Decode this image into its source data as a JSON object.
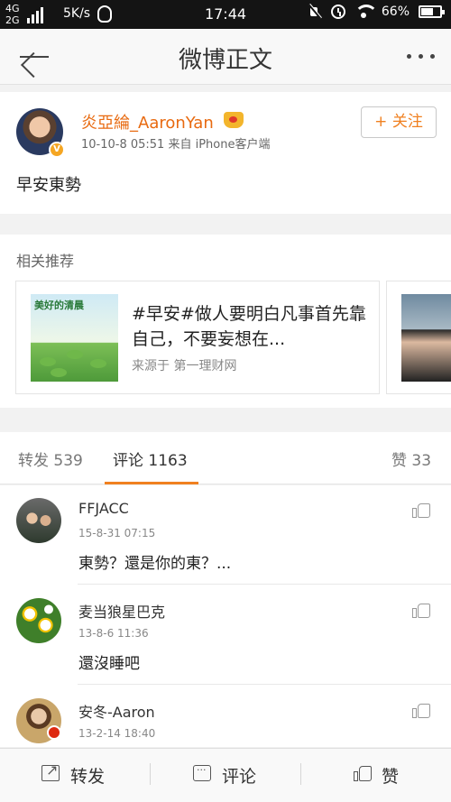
{
  "status_bar": {
    "network_top": "4G",
    "network_bottom": "2G",
    "speed": "5K/s",
    "time": "17:44",
    "battery": "66%"
  },
  "nav": {
    "title": "微博正文"
  },
  "post": {
    "author": "炎亞綸_AaronYan",
    "meta": "10-10-8 05:51  来自 iPhone客户端",
    "follow_label": "+ 关注",
    "text": "早安東勢"
  },
  "related": {
    "title": "相关推荐",
    "card": {
      "thumb_label": "美好的清晨",
      "title": "#早安#做人要明白凡事首先靠自己，不要妄想在...",
      "source": "来源于 第一理财网"
    }
  },
  "tabs": {
    "repost": "转发 539",
    "comment": "评论 1163",
    "like": "赞 33"
  },
  "comments": [
    {
      "name": "FFJACC",
      "time": "15-8-31 07:15",
      "text": "東勢？還是你的東？..."
    },
    {
      "name": "麦当狼星巴克",
      "time": "13-8-6 11:36",
      "text": "還沒睡吧"
    },
    {
      "name": "安冬-Aaron",
      "time": "13-2-14 18:40",
      "text": ""
    }
  ],
  "bottom_bar": {
    "repost": "转发",
    "comment": "评论",
    "like": "赞"
  },
  "colors": {
    "accent": "#f08020",
    "username": "#e86a10"
  }
}
